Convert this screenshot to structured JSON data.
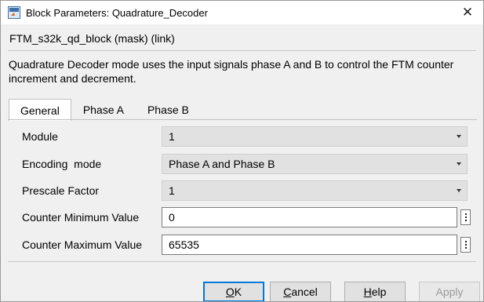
{
  "window": {
    "title": "Block Parameters: Quadrature_Decoder",
    "close_glyph": "✕"
  },
  "mask": {
    "title": "FTM_s32k_qd_block (mask) (link)",
    "description": "Quadrature Decoder mode uses the input signals phase A and B to control the FTM counter increment and decrement."
  },
  "tabs": [
    {
      "label": "General"
    },
    {
      "label": "Phase A"
    },
    {
      "label": "Phase B"
    }
  ],
  "params": {
    "module": {
      "label": "Module",
      "value": "1"
    },
    "encoding_mode": {
      "label": "Encoding  mode",
      "value": "Phase A and Phase B"
    },
    "prescale_factor": {
      "label": "Prescale Factor",
      "value": "1"
    },
    "counter_min": {
      "label": "Counter Minimum Value",
      "value": "0"
    },
    "counter_max": {
      "label": "Counter Maximum Value",
      "value": "65535"
    }
  },
  "buttons": {
    "ok": {
      "mnemonic": "O",
      "rest": "K"
    },
    "cancel": {
      "mnemonic": "C",
      "rest": "ancel"
    },
    "help": {
      "mnemonic": "H",
      "rest": "elp"
    },
    "apply": {
      "label": "Apply"
    }
  },
  "colors": {
    "accent": "#0078d7",
    "dialog_bg": "#f0f0f0",
    "dropdown_bg": "#e1e1e1"
  },
  "icons": {
    "app": "simulink-block-icon",
    "close": "close-icon",
    "dropdown": "chevron-down-icon",
    "field_menu": "more-vertical-icon"
  }
}
